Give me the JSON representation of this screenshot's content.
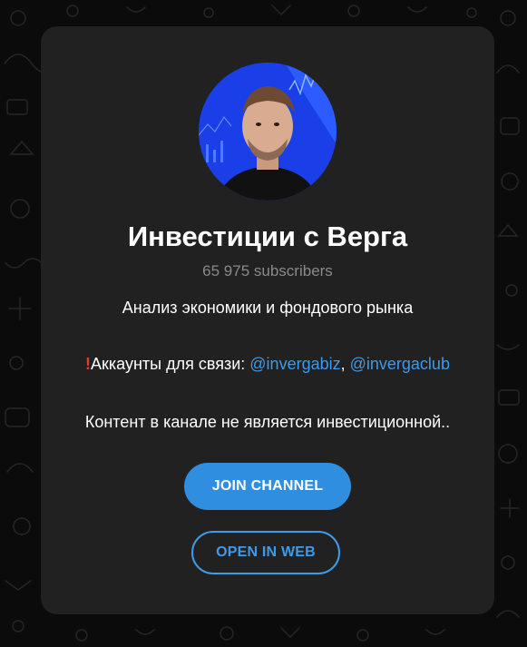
{
  "channel": {
    "title": "Инвестиции с Верга",
    "subscribers": "65 975 subscribers",
    "description_line1": "Анализ экономики и фондового рынка",
    "contacts_prefix": "Аккаунты для связи: ",
    "contact_link1": "@invergabiz",
    "contact_sep": ", ",
    "contact_link2": "@invergaclub",
    "description_line3": "Контент в канале не является инвестиционной.."
  },
  "buttons": {
    "join_label": "JOIN CHANNEL",
    "web_label": "OPEN IN WEB"
  },
  "icons": {
    "exclamation": "red-exclamation-icon",
    "avatar": "channel-avatar"
  },
  "colors": {
    "background": "#0b0b0b",
    "card": "#212121",
    "accent": "#3d9be9",
    "button_fill": "#2f8ee0",
    "subtitle": "#8a8a8a"
  }
}
